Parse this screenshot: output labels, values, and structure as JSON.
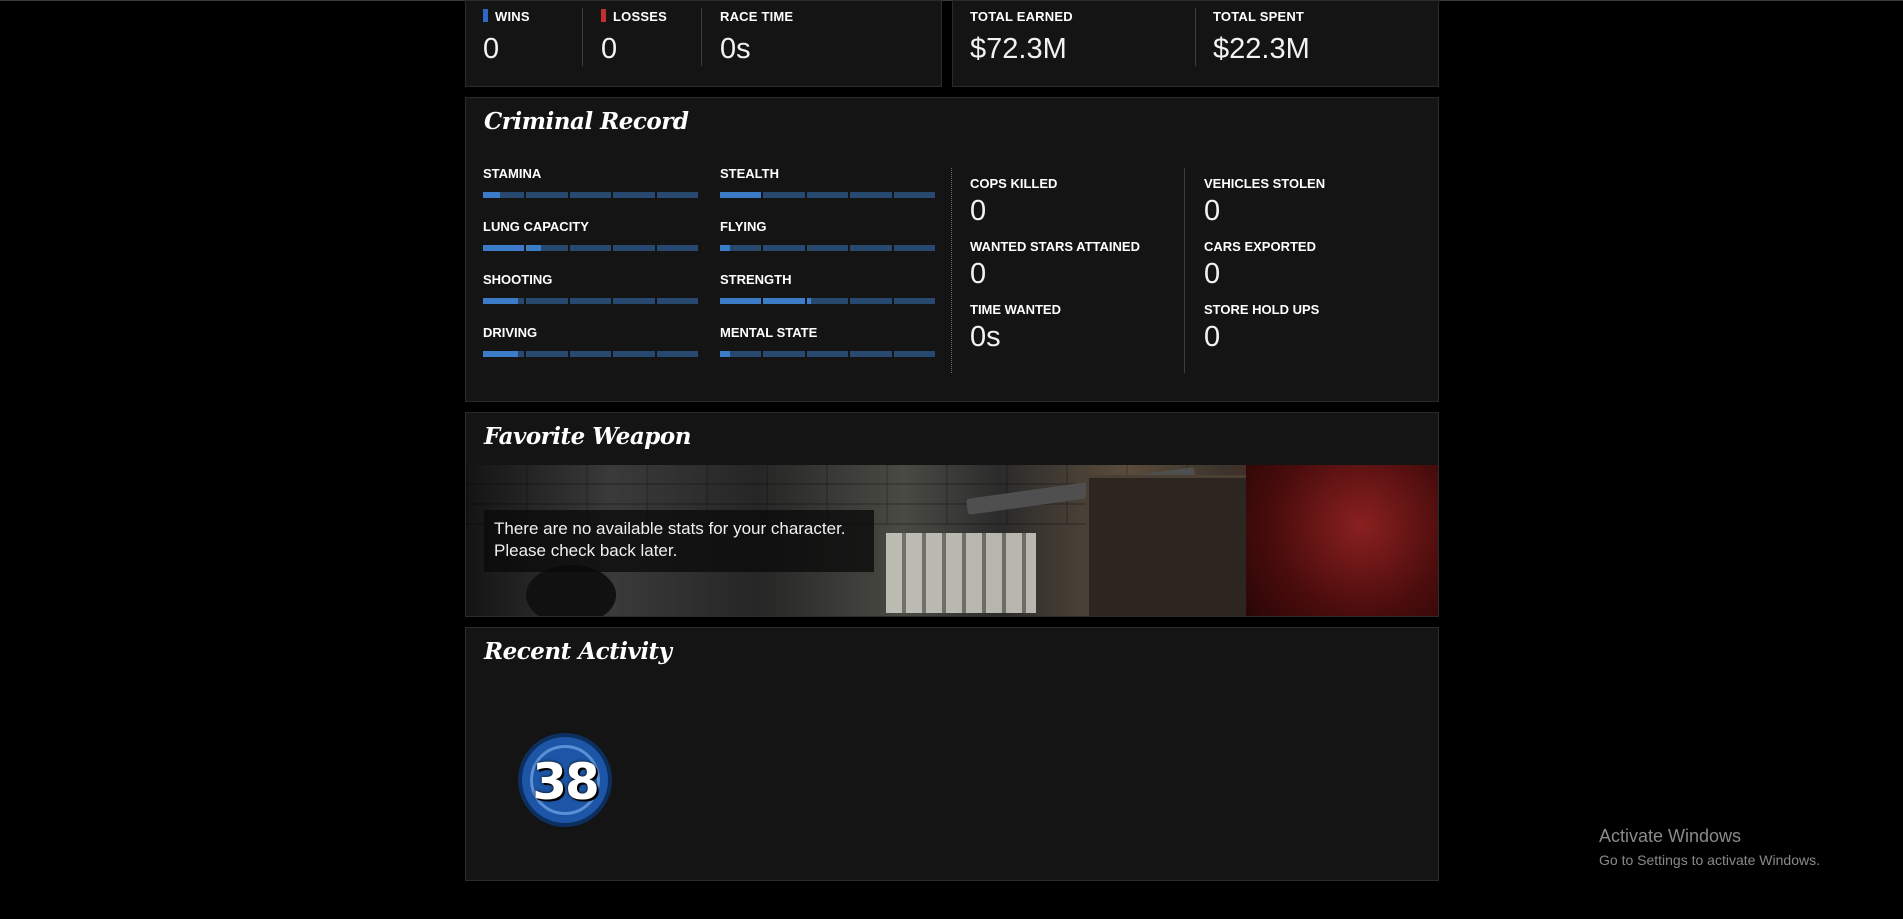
{
  "race": {
    "wins_label": "WINS",
    "wins_value": "0",
    "losses_label": "LOSSES",
    "losses_value": "0",
    "race_time_label": "RACE TIME",
    "race_time_value": "0s",
    "wins_color": "#2f67c4",
    "losses_color": "#c43030"
  },
  "money": {
    "earned_label": "TOTAL EARNED",
    "earned_value": "$72.3M",
    "spent_label": "TOTAL SPENT",
    "spent_value": "$22.3M"
  },
  "criminal_record": {
    "title": "Criminal Record",
    "skills": [
      {
        "label": "STAMINA",
        "level": 0.08
      },
      {
        "label": "STEALTH",
        "level": 0.2
      },
      {
        "label": "LUNG CAPACITY",
        "level": 0.27
      },
      {
        "label": "FLYING",
        "level": 0.05
      },
      {
        "label": "SHOOTING",
        "level": 0.17
      },
      {
        "label": "STRENGTH",
        "level": 0.42
      },
      {
        "label": "DRIVING",
        "level": 0.17
      },
      {
        "label": "MENTAL STATE",
        "level": 0.05
      }
    ],
    "records": {
      "cops_killed_label": "COPS KILLED",
      "cops_killed_value": "0",
      "wanted_stars_label": "WANTED STARS ATTAINED",
      "wanted_stars_value": "0",
      "time_wanted_label": "TIME WANTED",
      "time_wanted_value": "0s",
      "vehicles_stolen_label": "VEHICLES STOLEN",
      "vehicles_stolen_value": "0",
      "cars_exported_label": "CARS EXPORTED",
      "cars_exported_value": "0",
      "store_holdups_label": "STORE HOLD UPS",
      "store_holdups_value": "0"
    }
  },
  "favorite_weapon": {
    "title": "Favorite Weapon",
    "message_line1": "There are no available stats for your character.",
    "message_line2": "Please check back later."
  },
  "recent_activity": {
    "title": "Recent Activity",
    "badge_number": "38"
  },
  "windows_watermark": {
    "line1": "Activate Windows",
    "line2": "Go to Settings to activate Windows."
  },
  "colors": {
    "bar_track": "#27496f",
    "bar_fill": "#3b7bc8"
  }
}
